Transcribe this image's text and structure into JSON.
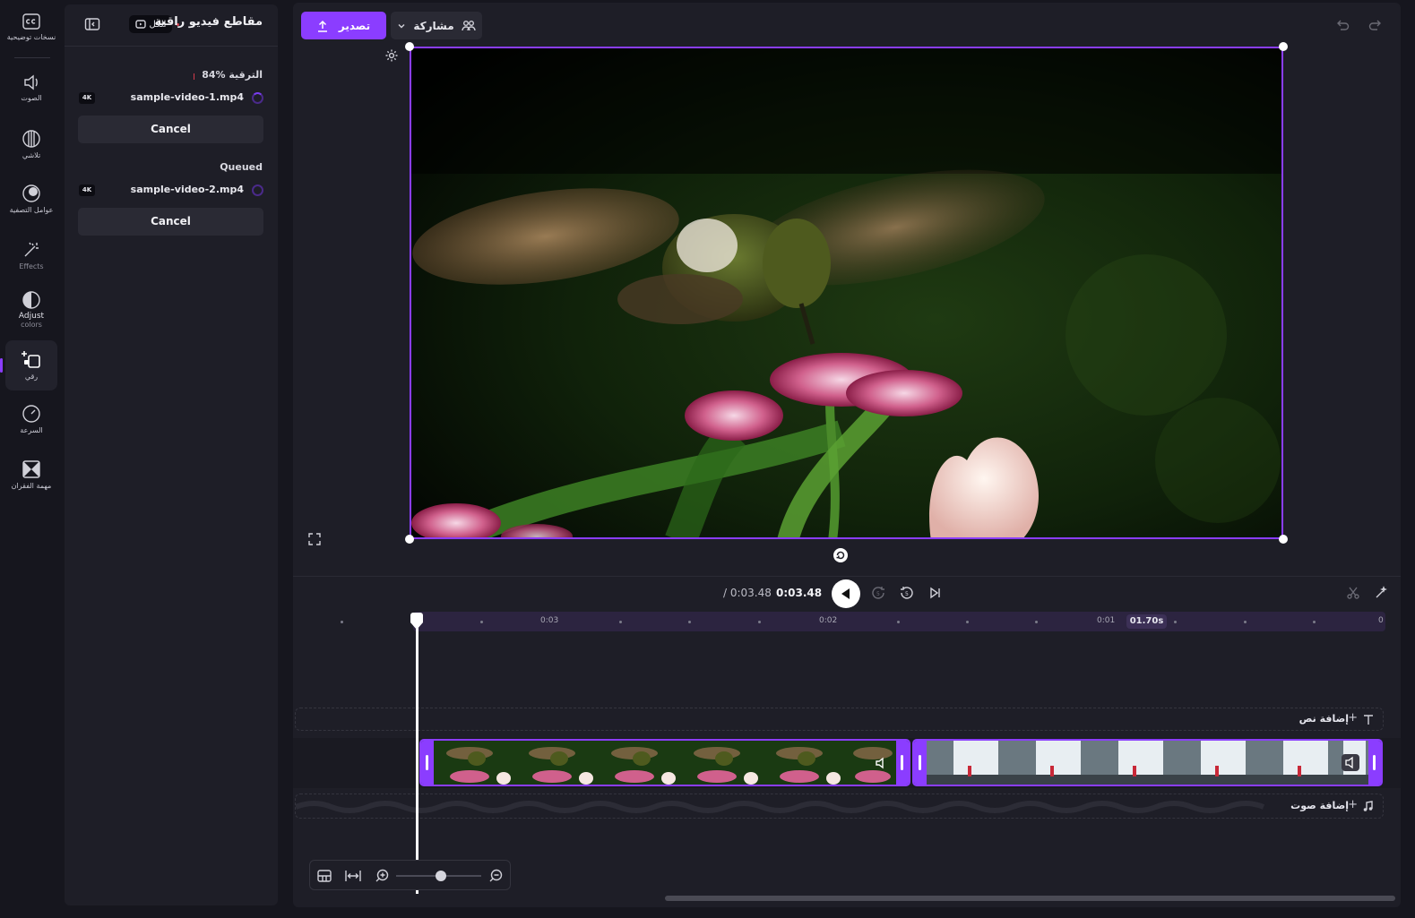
{
  "rail": {
    "items": [
      {
        "icon": "captions-icon",
        "label": "نسخات توضيحية"
      },
      {
        "icon": "audio-icon",
        "label": "الصوت"
      },
      {
        "icon": "fade-icon",
        "label": "تلاشي"
      },
      {
        "icon": "filters-icon",
        "label": "عوامل التصفية"
      },
      {
        "icon": "effects-icon",
        "label": "Effects"
      },
      {
        "icon": "adjust-colors-icon",
        "label": "Adjust",
        "sublabel": "colors"
      },
      {
        "icon": "upscale-icon",
        "label": "رقي",
        "active": true
      },
      {
        "icon": "speed-icon",
        "label": "السرعة"
      },
      {
        "icon": "transition-icon",
        "label": "مهمة الفقران"
      }
    ]
  },
  "panel": {
    "title": "مقاطع فيديو راقية",
    "all_label": "الكل",
    "jobs": [
      {
        "status": "84% الترقية",
        "file": "sample-video-1.mp4",
        "badge": "4K",
        "cancel": "Cancel",
        "busy": true
      },
      {
        "status": "Queued",
        "file": "sample-video-2.mp4",
        "badge": "4K",
        "cancel": "Cancel",
        "busy": false
      }
    ]
  },
  "toolbar": {
    "export_label": "تصدير",
    "share_label": "مشاركة"
  },
  "transport": {
    "current_time": "0:03.48",
    "total_time": "/ 0:03.48"
  },
  "ruler": {
    "labels": [
      "0",
      "0:01",
      "0:02",
      "0:03"
    ],
    "marker": "01.70s"
  },
  "tracks": {
    "text_add": "إضافة نص",
    "audio_add": "إضافة صوت"
  },
  "colors": {
    "accent": "#8b3dff",
    "background": "#16161e",
    "panel": "#1e1e27"
  }
}
